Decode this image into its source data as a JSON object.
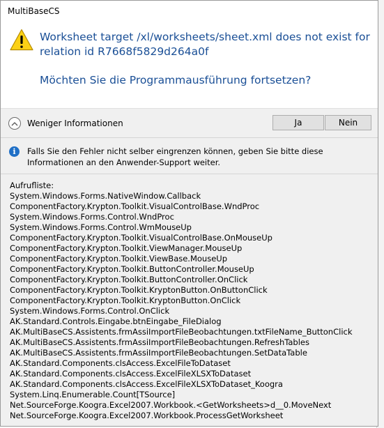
{
  "window": {
    "title": "MultiBaseCS"
  },
  "message": {
    "icon": "warning-icon",
    "text": "Worksheet target /xl/worksheets/sheet.xml does not exist for relation id R7668f5829d264a0f",
    "question": "Möchten Sie die Programmausführung fortsetzen?",
    "color": "#1a4f96"
  },
  "toggle": {
    "label": "Weniger Informationen",
    "icon": "chevron-up-icon"
  },
  "buttons": {
    "yes": "Ja",
    "no": "Nein"
  },
  "info": {
    "icon": "info-icon",
    "text": "Falls Sie den Fehler nicht selber eingrenzen können, geben Sie bitte diese Informationen an den Anwender-Support weiter."
  },
  "stack": {
    "header": "Aufrufliste:",
    "lines": [
      "System.Windows.Forms.NativeWindow.Callback",
      "ComponentFactory.Krypton.Toolkit.VisualControlBase.WndProc",
      "System.Windows.Forms.Control.WndProc",
      "System.Windows.Forms.Control.WmMouseUp",
      "ComponentFactory.Krypton.Toolkit.VisualControlBase.OnMouseUp",
      "ComponentFactory.Krypton.Toolkit.ViewManager.MouseUp",
      "ComponentFactory.Krypton.Toolkit.ViewBase.MouseUp",
      "ComponentFactory.Krypton.Toolkit.ButtonController.MouseUp",
      "ComponentFactory.Krypton.Toolkit.ButtonController.OnClick",
      "ComponentFactory.Krypton.Toolkit.KryptonButton.OnButtonClick",
      "ComponentFactory.Krypton.Toolkit.KryptonButton.OnClick",
      "System.Windows.Forms.Control.OnClick",
      "AK.Standard.Controls.Eingabe.btnEingabe_FileDialog",
      "AK.MultiBaseCS.Assistents.frmAssiImportFileBeobachtungen.txtFileName_ButtonClick",
      "AK.MultiBaseCS.Assistents.frmAssiImportFileBeobachtungen.RefreshTables",
      "AK.MultiBaseCS.Assistents.frmAssiImportFileBeobachtungen.SetDataTable",
      "AK.Standard.Components.clsAccess.ExcelFileToDataset",
      "AK.Standard.Components.clsAccess.ExcelFileXLSXToDataset",
      "AK.Standard.Components.clsAccess.ExcelFileXLSXToDataset_Koogra",
      "System.Linq.Enumerable.Count[TSource]",
      "Net.SourceForge.Koogra.Excel2007.Workbook.<GetWorksheets>d__0.MoveNext",
      "Net.SourceForge.Koogra.Excel2007.Workbook.ProcessGetWorksheet"
    ]
  }
}
